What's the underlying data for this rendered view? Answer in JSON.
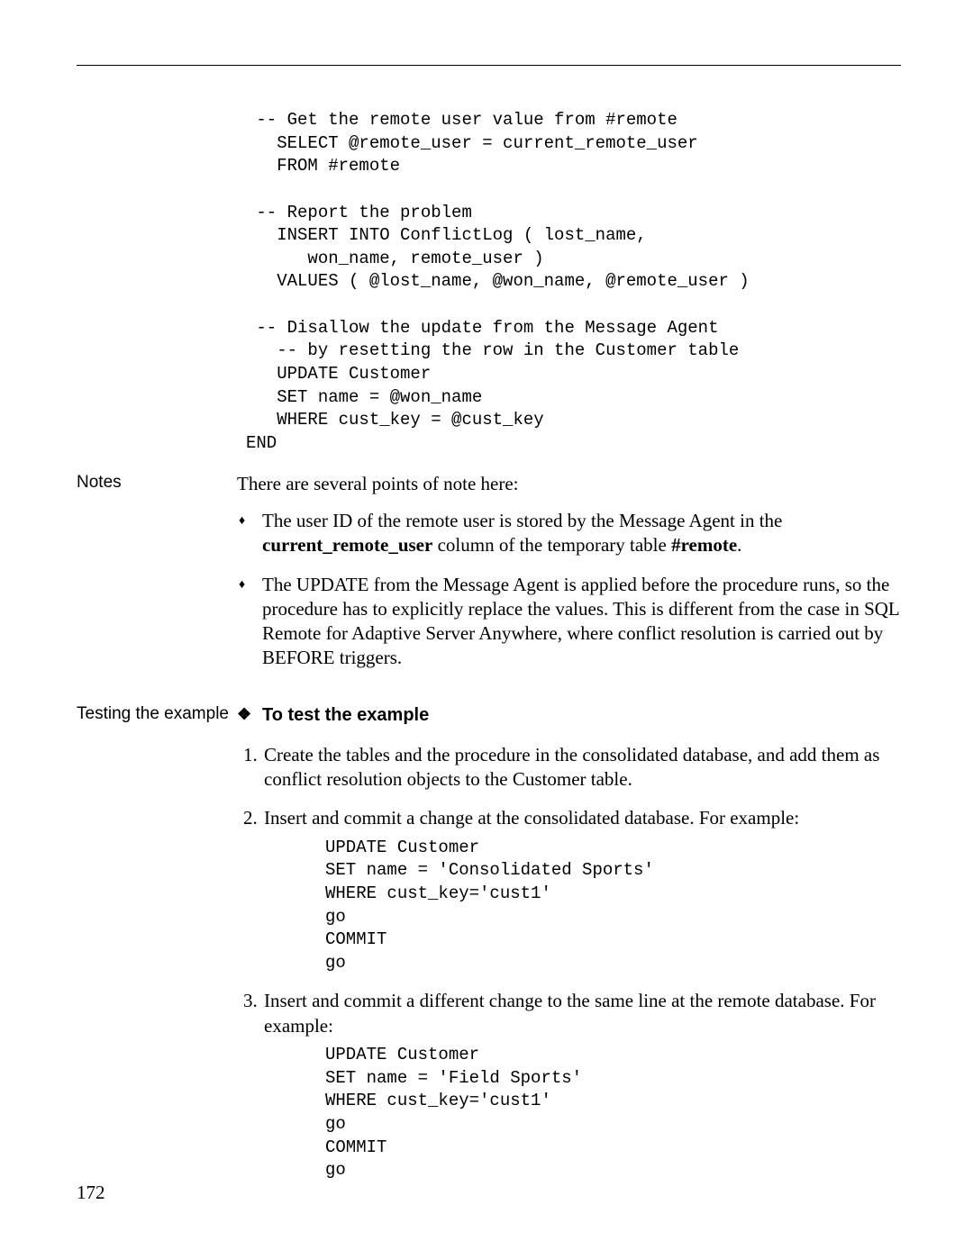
{
  "code_block_1": " -- Get the remote user value from #remote\n   SELECT @remote_user = current_remote_user\n   FROM #remote\n\n -- Report the problem\n   INSERT INTO ConflictLog ( lost_name,\n      won_name, remote_user )\n   VALUES ( @lost_name, @won_name, @remote_user )\n\n -- Disallow the update from the Message Agent\n   -- by resetting the row in the Customer table\n   UPDATE Customer\n   SET name = @won_name\n   WHERE cust_key = @cust_key\nEND",
  "notes_label": "Notes",
  "notes_intro": "There are several points of note here:",
  "bullet1_a": "The user ID of the remote user is stored by the Message Agent in the ",
  "bullet1_b": "current_remote_user",
  "bullet1_c": " column of the temporary table ",
  "bullet1_d": "#remote",
  "bullet1_e": ".",
  "bullet2": "The UPDATE from the Message Agent is applied before the procedure runs, so the procedure has to explicitly replace the values. This is different from the case in SQL Remote for Adaptive Server Anywhere, where conflict resolution is carried out by BEFORE triggers.",
  "testing_label": "Testing the example",
  "procedure_heading": "To test the example",
  "step1": "Create the tables and the procedure in the consolidated database, and add them as conflict resolution objects to the Customer table.",
  "step2": "Insert and commit a change at the consolidated database. For example:",
  "code_block_2": "UPDATE Customer\nSET name = 'Consolidated Sports'\nWHERE cust_key='cust1'\ngo\nCOMMIT\ngo",
  "step3": "Insert and commit a different change to the same line at the remote database. For example:",
  "code_block_3": "UPDATE Customer\nSET name = 'Field Sports'\nWHERE cust_key='cust1'\ngo\nCOMMIT\ngo",
  "page_number": "172"
}
